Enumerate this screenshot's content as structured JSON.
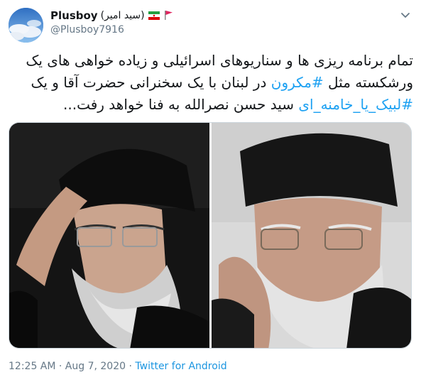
{
  "tweet": {
    "display_name": "Plusboy",
    "display_suffix": "(سید امیر)",
    "handle": "@Plusboy7916",
    "text_lines": [
      [
        "تمام برنامه ریزی ها و سناریوهای اسرائیلی و زیاده خواهی های یک"
      ],
      [
        "ورشکسته مثل ",
        "#مکرون",
        " در لبنان با یک سخنرانی حضرت آقا و یک"
      ],
      [
        "#لبیک_یا_خامنه_ای",
        "   سید حسن نصرالله به فنا خواهد رفت..."
      ]
    ],
    "timestamp": "12:25 AM · Aug 7, 2020",
    "separator": " · ",
    "source": "Twitter for Android"
  },
  "icons": {
    "menu": "chevron-down-icon",
    "flags": [
      "iran-flag-icon",
      "red-flag-icon"
    ]
  },
  "colors": {
    "link": "#1da1f2",
    "secondary_text": "#657786",
    "border": "#ccd6dd"
  }
}
